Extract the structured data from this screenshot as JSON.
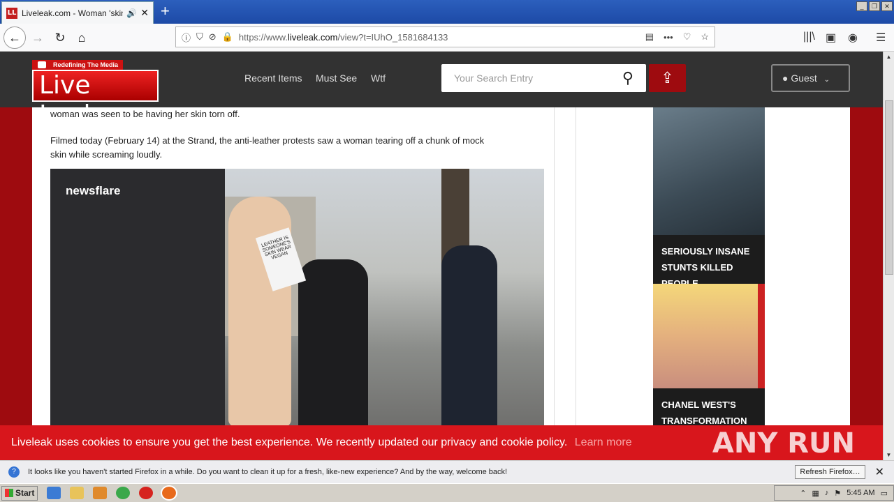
{
  "browser": {
    "tab_title": "Liveleak.com - Woman 'skinned",
    "tab_favicon_text": "LL",
    "url_prefix": "https://www.",
    "url_domain": "liveleak.com",
    "url_path": "/view?t=IUhO_1581684133",
    "more_label": "•••"
  },
  "site": {
    "logo_tagline": "Redefining The Media",
    "logo_text": "Live Leak",
    "nav": [
      "Recent Items",
      "Must See",
      "Wtf"
    ],
    "search_placeholder": "Your Search Entry",
    "guest_label": "Guest"
  },
  "article": {
    "line_top": "woman was seen to be having her skin torn off.",
    "para1_line1": "Filmed today (February 14) at the Strand, the anti-leather protests saw a woman tearing off a chunk of mock",
    "para1_line2": "skin while screaming loudly.",
    "video_watermark": "newsflare",
    "sign_text": "LEATHER IS SOMEONE'S SKIN WEAR VEGAN"
  },
  "sidebar": {
    "ad1_caption": "SERIOUSLY INSANE STUNTS THAT KILLED PEOPLE",
    "ad1_caption_visible": "SERIOUSLY INSANE STUNTS KILLED PEOPLE",
    "ad2_caption": "CHANEL WEST'S TRANSFORMATION IS"
  },
  "cookie": {
    "message": "Liveleak uses cookies to ensure you get the best experience. We recently updated our privacy and cookie policy.",
    "learn_more": "Learn more",
    "watermark": "ANY RUN"
  },
  "notification": {
    "message": "It looks like you haven't started Firefox in a while. Do you want to clean it up for a fresh, like-new experience? And by the way, welcome back!",
    "button": "Refresh Firefox…"
  },
  "taskbar": {
    "start": "Start",
    "clock": "5:45 AM"
  }
}
